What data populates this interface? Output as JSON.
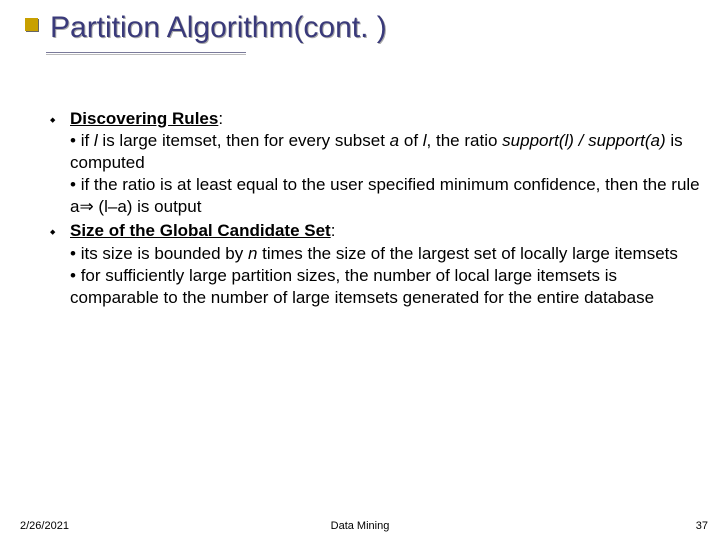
{
  "title": "Partition Algorithm(cont. )",
  "section1": {
    "heading": "Discovering Rules",
    "bullets": [
      {
        "pre": "if ",
        "i1": "l",
        "mid1": " is large itemset, then for every subset ",
        "i2": "a",
        "mid2": " of ",
        "i3": "l",
        "mid3": ", the ratio ",
        "i4": "support(l) / support(a)",
        "post": " is computed"
      },
      {
        "text": "if the ratio is at least equal to the user specified minimum confidence, then the rule a⇒ (l–a) is output"
      }
    ]
  },
  "section2": {
    "heading": "Size of the Global Candidate Set",
    "bullets": [
      {
        "pre": "its size is bounded by ",
        "i1": "n",
        "post": " times the size of the largest set of locally large itemsets"
      },
      {
        "text": "for sufficiently large partition sizes, the number of local large itemsets is comparable to the number of large itemsets generated for the entire database"
      }
    ]
  },
  "footer": {
    "date": "2/26/2021",
    "label": "Data Mining",
    "page": "37"
  }
}
